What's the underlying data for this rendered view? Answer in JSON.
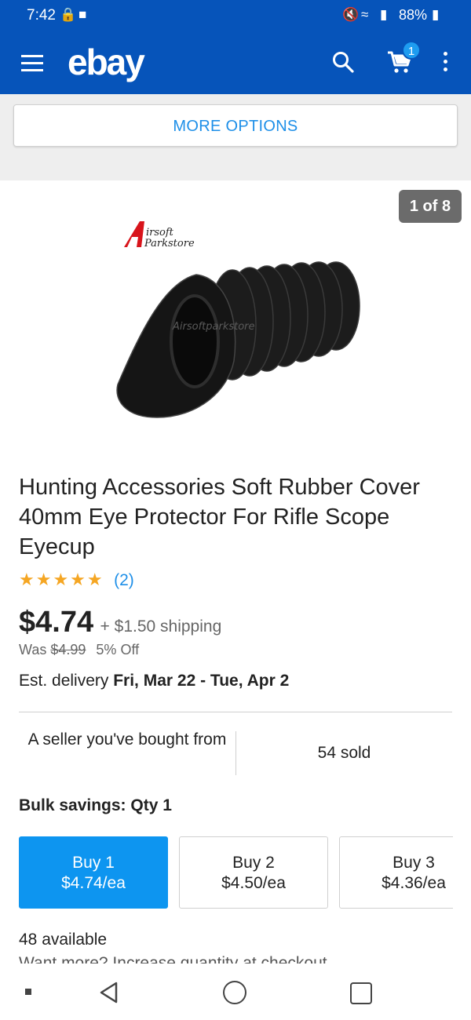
{
  "status_bar": {
    "time": "7:42",
    "battery": "88%"
  },
  "header": {
    "logo": "ebay",
    "cart_count": "1"
  },
  "more_options_label": "MORE OPTIONS",
  "gallery": {
    "counter": "1 of 8",
    "watermark_brand_line1": "irsoft",
    "watermark_brand_line2": "Parkstore",
    "watermark_center": "Airsoftparkstore"
  },
  "product": {
    "title": "Hunting Accessories Soft Rubber Cover 40mm Eye Protector For Rifle Scope Eyecup",
    "stars": "★★★★★",
    "rating_value": 5,
    "rating_count": "(2)",
    "price": "$4.74",
    "shipping": "+ $1.50 shipping",
    "was_label": "Was",
    "was_price": "$4.99",
    "discount": "5% Off",
    "delivery_label": "Est. delivery",
    "delivery_dates": "Fri, Mar 22 - Tue, Apr 2"
  },
  "seller": {
    "note": "A seller you've bought from",
    "sold": "54 sold"
  },
  "bulk": {
    "title": "Bulk savings: Qty 1",
    "options": [
      {
        "label": "Buy 1",
        "price": "$4.74/ea",
        "selected": true
      },
      {
        "label": "Buy 2",
        "price": "$4.50/ea",
        "selected": false
      },
      {
        "label": "Buy 3",
        "price": "$4.36/ea",
        "selected": false
      }
    ]
  },
  "availability": {
    "available": "48 available",
    "want_more": "Want more? Increase quantity at checkout"
  },
  "colors": {
    "brand_blue": "#0654ba",
    "accent_blue": "#0d95f0",
    "star": "#f5a623"
  }
}
